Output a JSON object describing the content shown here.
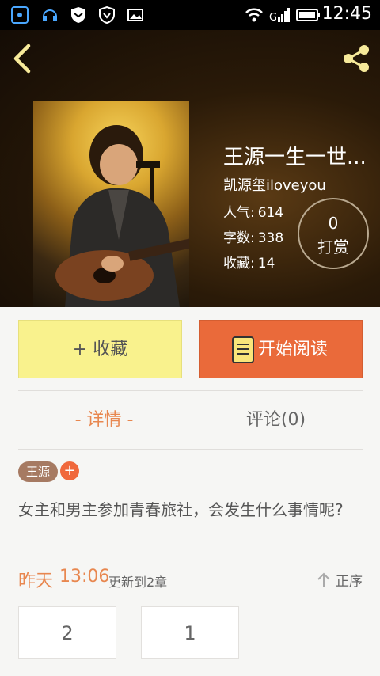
{
  "status_bar": {
    "time": "12:45"
  },
  "book": {
    "title": "王源一生一世...",
    "author": "凯源玺iloveyou",
    "stats": [
      {
        "label": "人气:",
        "value": "614"
      },
      {
        "label": "字数:",
        "value": "338"
      },
      {
        "label": "收藏:",
        "value": "14"
      }
    ],
    "reward": {
      "count": "0",
      "label": "打赏"
    }
  },
  "actions": {
    "collect_label": "+ 收藏",
    "read_label": "开始阅读"
  },
  "tabs": [
    {
      "label": "- 详情 -"
    },
    {
      "label": "评论(0)"
    }
  ],
  "tags": [
    "王源"
  ],
  "tag_add": "+",
  "description": "女主和男主参加青春旅社，会发生什么事情呢?",
  "update": {
    "day": "昨天",
    "time": "13:06",
    "text": "更新到2章",
    "sort_label": "正序"
  },
  "chapters": [
    "2",
    "1"
  ],
  "colors": {
    "accent": "#ea6a3a",
    "collect_bg": "#f9f28d",
    "tag_bg": "#a67a62"
  }
}
